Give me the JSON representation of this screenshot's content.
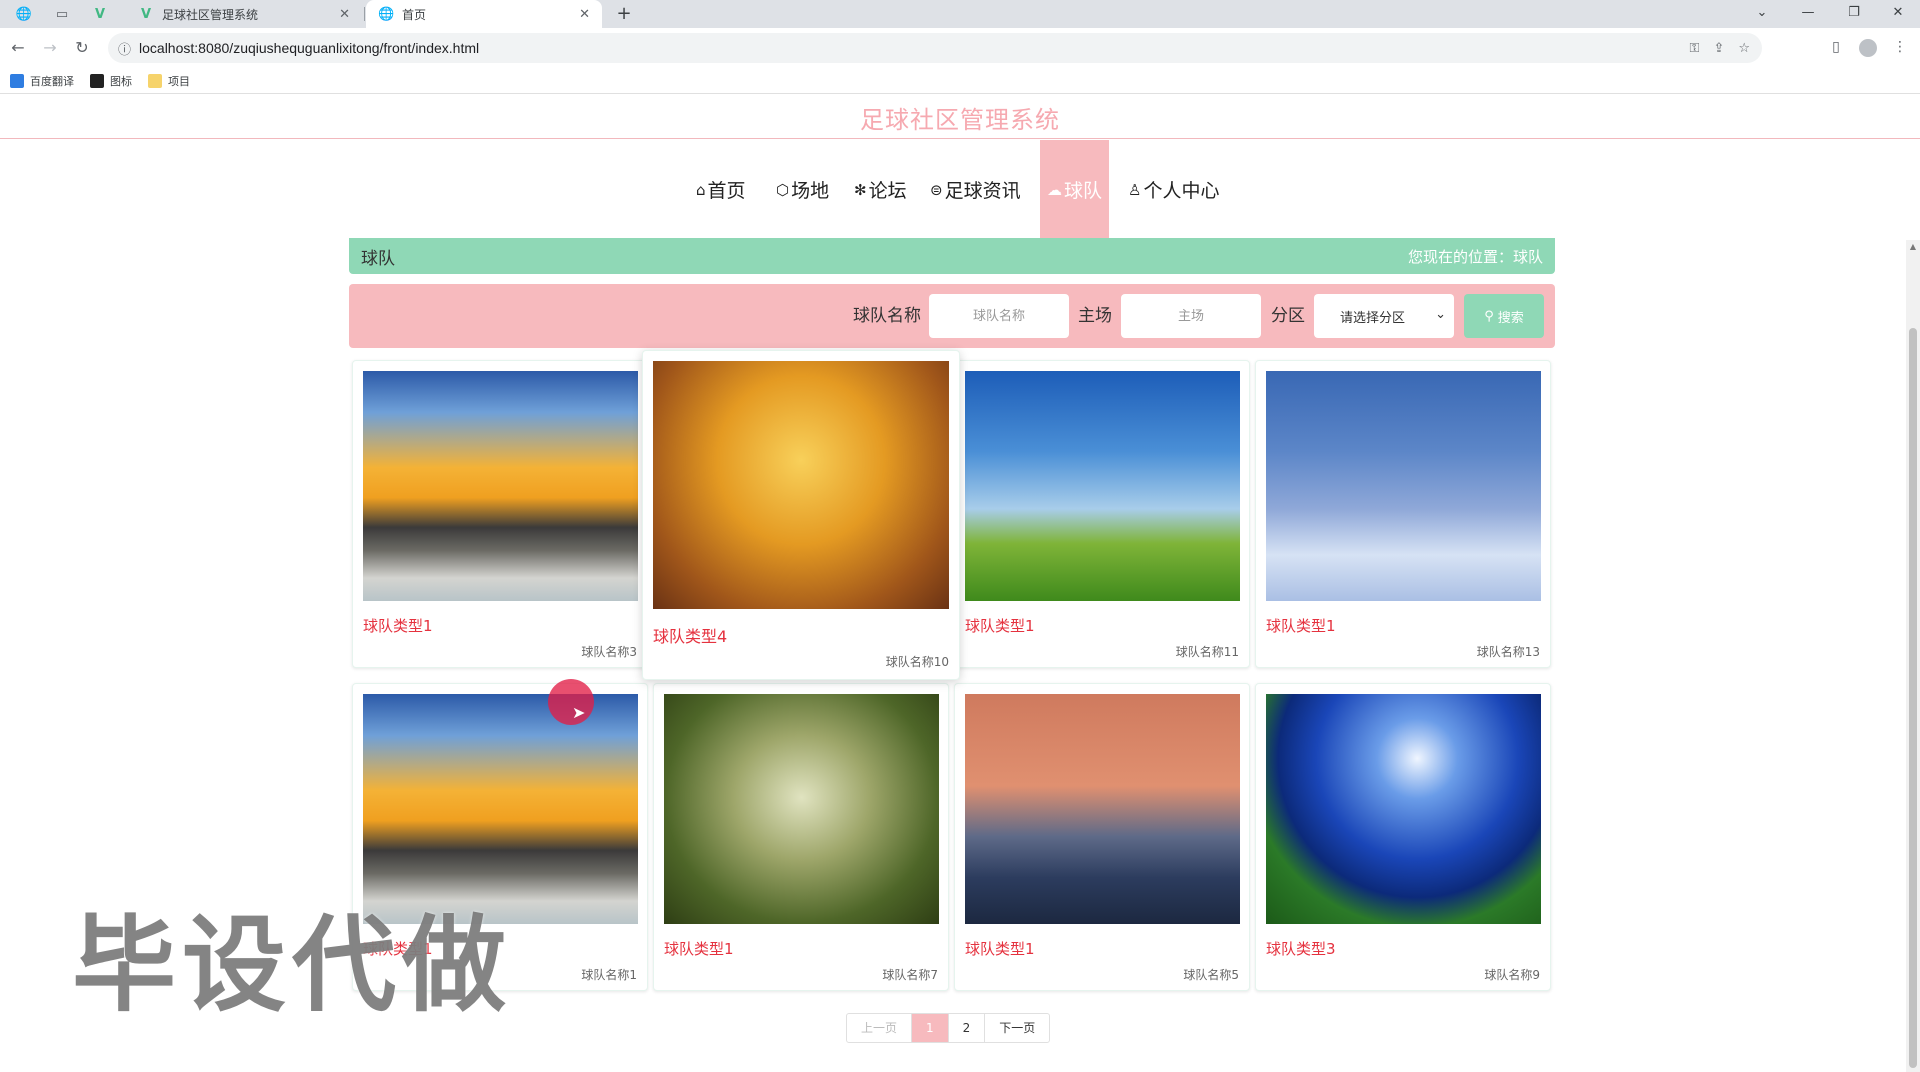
{
  "browser": {
    "tabs": [
      {
        "title": "足球社区管理系统",
        "active": false
      },
      {
        "title": "首页",
        "active": true
      }
    ],
    "url": "localhost:8080/zuqiushequguanlixitong/front/index.html",
    "bookmarks": [
      "百度翻译",
      "图标",
      "项目"
    ]
  },
  "site": {
    "title": "足球社区管理系统"
  },
  "nav": {
    "items": [
      {
        "label": "首页",
        "icon": "home-icon"
      },
      {
        "label": "场地",
        "icon": "venue-icon"
      },
      {
        "label": "论坛",
        "icon": "forum-icon"
      },
      {
        "label": "足球资讯",
        "icon": "news-icon"
      },
      {
        "label": "球队",
        "icon": "team-icon",
        "active": true
      },
      {
        "label": "个人中心",
        "icon": "user-icon"
      }
    ]
  },
  "breadcrumb": {
    "title": "球队",
    "position": "您现在的位置：球队"
  },
  "filters": {
    "team_name_label": "球队名称",
    "team_name_placeholder": "球队名称",
    "home_label": "主场",
    "home_placeholder": "主场",
    "division_label": "分区",
    "division_select": "请选择分区",
    "search_label": "搜索"
  },
  "cards": [
    {
      "type": "球队类型1",
      "name": "球队名称3",
      "image": "sunset-beach"
    },
    {
      "type": "球队类型4",
      "name": "球队名称10",
      "image": "autumn-trees"
    },
    {
      "type": "球队类型1",
      "name": "球队名称11",
      "image": "blue-sky-grass"
    },
    {
      "type": "球队类型1",
      "name": "球队名称13",
      "image": "snow-house"
    },
    {
      "type": "球队类型1",
      "name": "球队名称1",
      "image": "sunset-beach"
    },
    {
      "type": "球队类型1",
      "name": "球队名称7",
      "image": "forest-path"
    },
    {
      "type": "球队类型1",
      "name": "球队名称5",
      "image": "lake-sunset"
    },
    {
      "type": "球队类型3",
      "name": "球队名称9",
      "image": "moon-meadow"
    }
  ],
  "pagination": {
    "prev": "上一页",
    "pages": [
      "1",
      "2"
    ],
    "current": "1",
    "next": "下一页"
  },
  "watermark": "毕设代做"
}
